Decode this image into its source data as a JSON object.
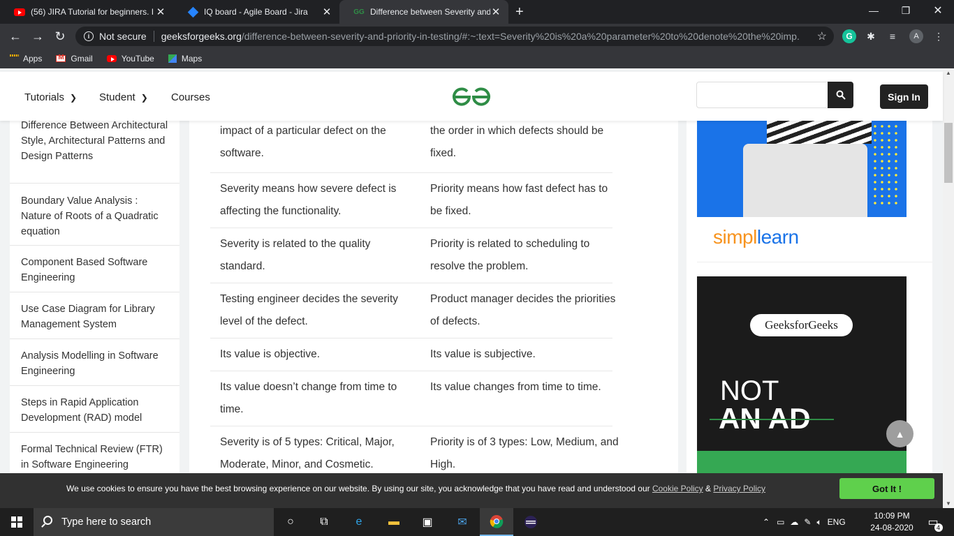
{
  "browser": {
    "tabs": [
      {
        "label": "(56) JIRA Tutorial for beginners. I",
        "favicon": "youtube-icon",
        "active": false
      },
      {
        "label": "IQ board - Agile Board - Jira",
        "favicon": "jira-icon",
        "active": false
      },
      {
        "label": "Difference between Severity and",
        "favicon": "gfg-icon",
        "active": true
      }
    ],
    "new_tab_symbol": "+",
    "window_controls": {
      "minimize": "—",
      "restore": "❐",
      "close": "✕"
    },
    "security_label": "Not secure",
    "url_domain": "geeksforgeeks.org",
    "url_path": "/difference-between-severity-and-priority-in-testing/#:~:text=Severity%20is%20a%20parameter%20to%20denote%20the%20imp...",
    "profile_initial": "A",
    "grammarly_initial": "G",
    "bookmarks": [
      {
        "label": "Apps",
        "icon": "apps-grid-icon"
      },
      {
        "label": "Gmail",
        "icon": "gmail-icon"
      },
      {
        "label": "YouTube",
        "icon": "youtube-icon"
      },
      {
        "label": "Maps",
        "icon": "maps-icon"
      }
    ]
  },
  "site_header": {
    "nav": [
      {
        "label": "Tutorials",
        "has_dropdown": true
      },
      {
        "label": "Student",
        "has_dropdown": true
      },
      {
        "label": "Courses",
        "has_dropdown": false
      }
    ],
    "search_placeholder": "",
    "signin_label": "Sign In",
    "brand_color": "#2f8d46"
  },
  "sidebar": {
    "items": [
      {
        "label": "Difference Between Architectural Style, Architectural Patterns and Design Patterns"
      },
      {
        "label": "Boundary Value Analysis : Nature of Roots of a Quadratic equation"
      },
      {
        "label": "Component Based Software Engineering"
      },
      {
        "label": "Use Case Diagram for Library Management System"
      },
      {
        "label": "Analysis Modelling in Software Engineering"
      },
      {
        "label": "Steps in Rapid Application Development (RAD) model"
      },
      {
        "label": "Formal Technical Review (FTR) in Software Engineering"
      }
    ]
  },
  "comparison_table": {
    "rows": [
      {
        "severity": "impact of a particular defect on the software.",
        "priority": "the order in which defects should be fixed."
      },
      {
        "severity": "Severity means how severe defect is affecting the functionality.",
        "priority": "Priority means how fast defect has to be fixed."
      },
      {
        "severity": "Severity is related to the quality standard.",
        "priority": "Priority is related to scheduling to resolve the problem."
      },
      {
        "severity": "Testing engineer decides the severity level of the defect.",
        "priority": "Product manager decides the priorities of defects."
      },
      {
        "severity": "Its value is objective.",
        "priority": "Its value is subjective."
      },
      {
        "severity": "Its value doesn’t change from time to time.",
        "priority": "Its value changes from time to time."
      },
      {
        "severity": "Severity is of 5 types: Critical, Major, Moderate, Minor, and Cosmetic.",
        "priority": "Priority is of 3 types: Low, Medium, and High."
      }
    ]
  },
  "ads": {
    "simplilearn_brand_a": "simpl",
    "simplilearn_brand_b": "learn",
    "gfg_badge": "GeeksforGeeks",
    "not_text": "NOT",
    "an_ad_text": "AN AD"
  },
  "scroll_top_symbol": "▲",
  "cookie_bar": {
    "message": "We use cookies to ensure you have the best browsing experience on our website. By using our site, you acknowledge that you have read and understood our ",
    "cookie_policy": "Cookie Policy",
    "amp": " & ",
    "privacy_policy": "Privacy Policy",
    "button": "Got It !"
  },
  "taskbar": {
    "search_placeholder": "Type here to search",
    "language": "ENG",
    "time": "10:09 PM",
    "date": "24-08-2020",
    "notification_count": "4"
  }
}
